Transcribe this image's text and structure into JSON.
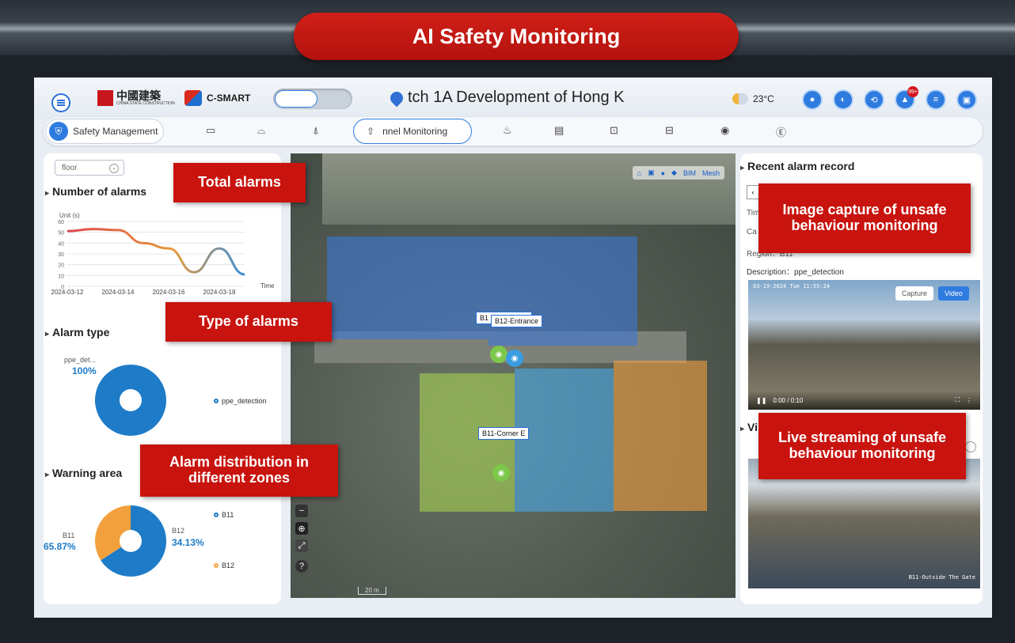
{
  "title": "AI Safety Monitoring",
  "header": {
    "logo_cn": "中國建築",
    "logo_en": "CHINA STATE CONSTRUCTION",
    "brand": "C-SMART",
    "project": "tch 1A Development of Hong K",
    "temperature": "23°C",
    "alert_badge": "99+"
  },
  "nav": {
    "safety_label": "Safety Management",
    "active_tab": "nnel Monitoring"
  },
  "left": {
    "floor_placeholder": "floor",
    "alarms_title": "Number of alarms",
    "unit": "Unit (s)",
    "x_axis_label": "Time",
    "alarm_type_title": "Alarm type",
    "alarm_type_label": "ppe_det...",
    "alarm_type_pct": "100%",
    "alarm_type_legend": "ppe_detection",
    "warning_title": "Warning area",
    "b11_label": "B11",
    "b11_pct": "65.87%",
    "b12_label": "B12",
    "b12_pct": "34.13%",
    "legend_b11": "B11",
    "legend_b12": "B12"
  },
  "chart_data": [
    {
      "type": "line",
      "title": "Number of alarms",
      "ylabel": "Unit (s)",
      "xlabel": "Time",
      "ylim": [
        0,
        60
      ],
      "yticks": [
        0,
        10,
        20,
        30,
        40,
        50,
        60
      ],
      "x": [
        "2024-03-12",
        "2024-03-13",
        "2024-03-14",
        "2024-03-15",
        "2024-03-16",
        "2024-03-17",
        "2024-03-18",
        "2024-03-19"
      ],
      "xtick_labels": [
        "2024-03-12",
        "2024-03-14",
        "2024-03-16",
        "2024-03-18"
      ],
      "values": [
        51,
        53,
        52,
        40,
        35,
        13,
        35,
        11
      ]
    },
    {
      "type": "pie",
      "title": "Alarm type",
      "labels": [
        "ppe_detection"
      ],
      "values": [
        100
      ]
    },
    {
      "type": "pie",
      "title": "Warning area",
      "labels": [
        "B11",
        "B12"
      ],
      "values": [
        65.87,
        34.13
      ]
    }
  ],
  "map": {
    "label_entrance": "B12-Entrance",
    "label_hidden": "B1",
    "label_hidden_tail": "ate",
    "label_corner": "B11-Corner E",
    "tool_bim": "BIM",
    "tool_mesh": "Mesh",
    "scale": "20 m"
  },
  "right": {
    "record_title": "Recent alarm record",
    "time_field": "Tim",
    "camera_field": "Ca",
    "region_field": "Region：B11",
    "description_field": "Description：ppe_detection",
    "video_timestamp": "03-19-2024 Tue 11:55:24",
    "capture_btn": "Capture",
    "video_btn": "Video",
    "video_time": "0:00 / 0:10",
    "live_title": "Vi",
    "live_label": "B11-Outside The Gate"
  },
  "callouts": {
    "total_alarms": "Total alarms",
    "type_of_alarms": "Type of alarms",
    "zones": "Alarm distribution in different zones",
    "image_capture": "Image capture of unsafe behaviour monitoring",
    "live_streaming": "Live streaming of unsafe behaviour monitoring"
  },
  "colors": {
    "accent": "#2f7ce0",
    "callout_red": "#c8130e",
    "pie_blue": "#1e7bc7",
    "pie_orange": "#f2a03d",
    "zone_blue": "#3a78d6",
    "zone_green": "#a5d24e",
    "zone_cyan": "#4aa8e8",
    "zone_orange": "#f2a03d"
  }
}
